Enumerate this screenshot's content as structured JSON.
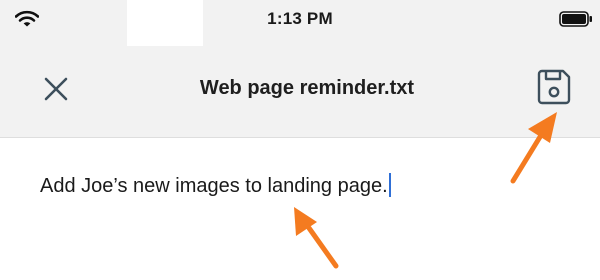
{
  "status_bar": {
    "time": "1:13 PM",
    "wifi_icon": "wifi-icon",
    "battery_icon": "battery-full-icon"
  },
  "toolbar": {
    "close_icon": "close-icon",
    "title": "Web page reminder.txt",
    "save_icon": "save-icon"
  },
  "editor": {
    "content": "Add Joe’s new images to landing page."
  },
  "colors": {
    "header_background": "#f2f2f2",
    "icon_color": "#3d4f5c",
    "cursor_color": "#2f6fd6",
    "annotation_arrow_color": "#f47b20"
  }
}
